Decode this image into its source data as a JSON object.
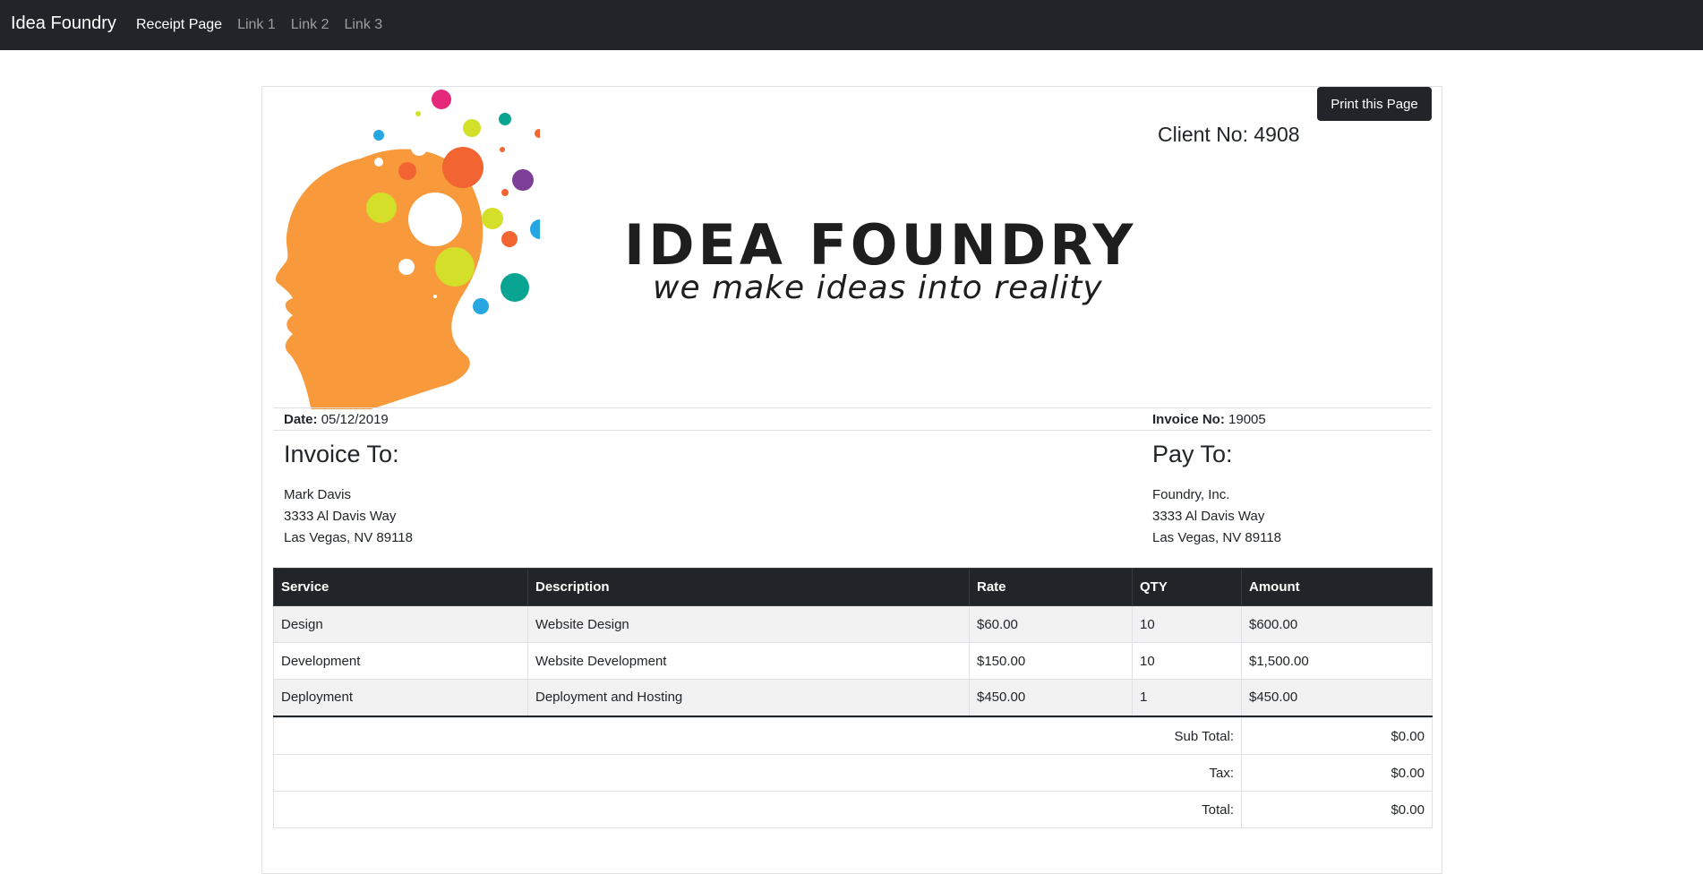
{
  "navbar": {
    "brand": "Idea Foundry",
    "links": [
      "Receipt Page",
      "Link 1",
      "Link 2",
      "Link 3"
    ]
  },
  "card": {
    "print_button": "Print this Page",
    "client_no_label": "Client No:",
    "client_no_value": "4908"
  },
  "logo": {
    "title": "IDEA FOUNDRY",
    "tagline": "we make ideas into reality"
  },
  "info": {
    "date_label": "Date:",
    "date_value": "05/12/2019",
    "invoice_no_label": "Invoice No:",
    "invoice_no_value": "19005"
  },
  "invoice_to": {
    "heading": "Invoice To:",
    "lines": [
      "Mark Davis",
      "3333 Al Davis Way",
      "Las Vegas, NV 89118"
    ]
  },
  "pay_to": {
    "heading": "Pay To:",
    "lines": [
      "Foundry, Inc.",
      "3333 Al Davis Way",
      "Las Vegas, NV 89118"
    ]
  },
  "table": {
    "headers": [
      "Service",
      "Description",
      "Rate",
      "QTY",
      "Amount"
    ],
    "rows": [
      [
        "Design",
        "Website Design",
        "$60.00",
        "10",
        "$600.00"
      ],
      [
        "Development",
        "Website Development",
        "$150.00",
        "10",
        "$1,500.00"
      ],
      [
        "Deployment",
        "Deployment and Hosting",
        "$450.00",
        "1",
        "$450.00"
      ]
    ]
  },
  "totals": {
    "sub_total_label": "Sub Total:",
    "sub_total_value": "$0.00",
    "tax_label": "Tax:",
    "tax_value": "$0.00",
    "total_label": "Total:",
    "total_value": "$0.00"
  },
  "colors": {
    "navbar": "#212529",
    "head": "#f89a3c",
    "dot_pink": "#e6287a",
    "dot_lime": "#d4df2a",
    "dot_teal": "#0aa592",
    "dot_blue": "#27a7e1",
    "dot_orange": "#f26532",
    "dot_purple": "#7d3f98"
  },
  "icons": {
    "logo": "head-with-bubbles-logo"
  }
}
